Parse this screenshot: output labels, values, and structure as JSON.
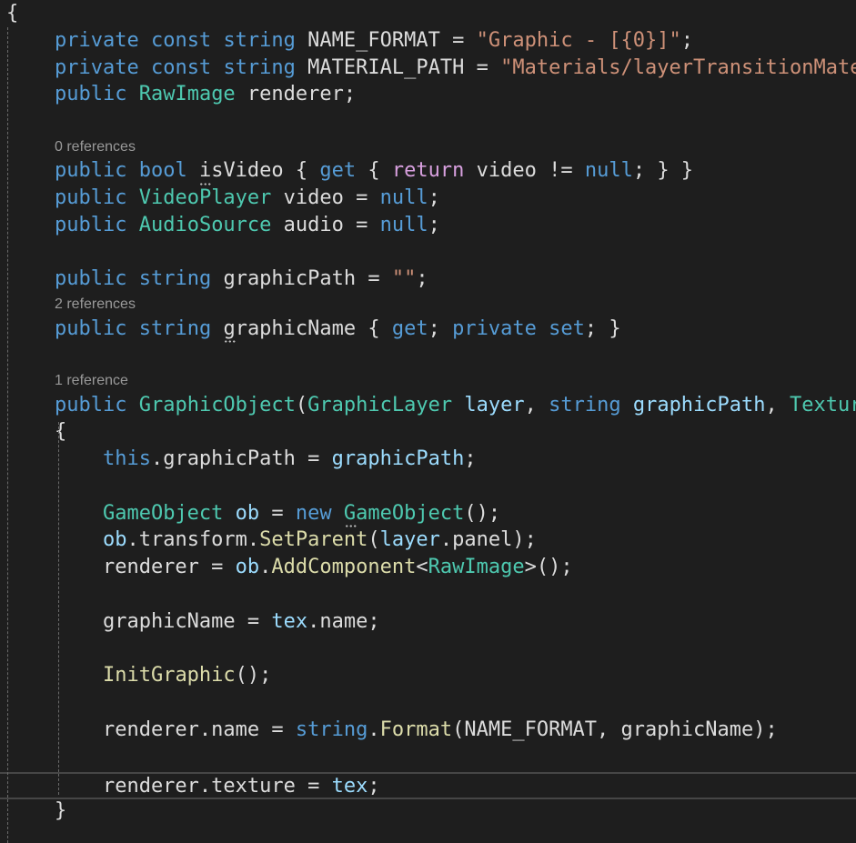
{
  "colors": {
    "background": "#1e1e1e",
    "keyword": "#569cd6",
    "type": "#4ec9b0",
    "string": "#ce9178",
    "variable": "#9cdcfe",
    "method": "#dcdcaa",
    "control": "#d8a0df",
    "text": "#dcdcdc",
    "codelens": "#999999"
  },
  "lines": [
    {
      "tokens": [
        [
          "{",
          "tx"
        ]
      ]
    },
    {
      "tokens": [
        [
          "    ",
          "tx"
        ],
        [
          "private",
          "kw"
        ],
        [
          " ",
          "tx"
        ],
        [
          "const",
          "kw"
        ],
        [
          " ",
          "tx"
        ],
        [
          "string",
          "kw"
        ],
        [
          " NAME_FORMAT = ",
          "tx"
        ],
        [
          "\"Graphic - [{0}]\"",
          "st"
        ],
        [
          ";",
          "tx"
        ]
      ]
    },
    {
      "tokens": [
        [
          "    ",
          "tx"
        ],
        [
          "private",
          "kw"
        ],
        [
          " ",
          "tx"
        ],
        [
          "const",
          "kw"
        ],
        [
          " ",
          "tx"
        ],
        [
          "string",
          "kw"
        ],
        [
          " MATERIAL_PATH = ",
          "tx"
        ],
        [
          "\"Materials/layerTransitionMate",
          "st"
        ]
      ]
    },
    {
      "tokens": [
        [
          "    ",
          "tx"
        ],
        [
          "public",
          "kw"
        ],
        [
          " ",
          "tx"
        ],
        [
          "RawImage",
          "ty"
        ],
        [
          " renderer;",
          "tx"
        ]
      ]
    },
    {
      "tokens": []
    },
    {
      "lens": "0 references"
    },
    {
      "tokens": [
        [
          "    ",
          "tx"
        ],
        [
          "public",
          "kw"
        ],
        [
          " ",
          "tx"
        ],
        [
          "bool",
          "kw"
        ],
        [
          " isVideo { ",
          "tx"
        ],
        [
          "get",
          "kw"
        ],
        [
          " { ",
          "tx"
        ],
        [
          "return",
          "ctl"
        ],
        [
          " video != ",
          "tx"
        ],
        [
          "null",
          "kw"
        ],
        [
          "; } }",
          "tx"
        ]
      ]
    },
    {
      "tokens": [
        [
          "    ",
          "tx"
        ],
        [
          "public",
          "kw"
        ],
        [
          " ",
          "tx"
        ],
        [
          "VideoPlayer",
          "ty"
        ],
        [
          " video = ",
          "tx"
        ],
        [
          "null",
          "kw"
        ],
        [
          ";",
          "tx"
        ]
      ]
    },
    {
      "tokens": [
        [
          "    ",
          "tx"
        ],
        [
          "public",
          "kw"
        ],
        [
          " ",
          "tx"
        ],
        [
          "AudioSource",
          "ty"
        ],
        [
          " audio = ",
          "tx"
        ],
        [
          "null",
          "kw"
        ],
        [
          ";",
          "tx"
        ]
      ]
    },
    {
      "tokens": []
    },
    {
      "tokens": [
        [
          "    ",
          "tx"
        ],
        [
          "public",
          "kw"
        ],
        [
          " ",
          "tx"
        ],
        [
          "string",
          "kw"
        ],
        [
          " graphicPath = ",
          "tx"
        ],
        [
          "\"\"",
          "st"
        ],
        [
          ";",
          "tx"
        ]
      ]
    },
    {
      "lens": "2 references"
    },
    {
      "tokens": [
        [
          "    ",
          "tx"
        ],
        [
          "public",
          "kw"
        ],
        [
          " ",
          "tx"
        ],
        [
          "string",
          "kw"
        ],
        [
          " graphicName { ",
          "tx"
        ],
        [
          "get",
          "kw"
        ],
        [
          "; ",
          "tx"
        ],
        [
          "private",
          "kw"
        ],
        [
          " ",
          "tx"
        ],
        [
          "set",
          "kw"
        ],
        [
          "; }",
          "tx"
        ]
      ]
    },
    {
      "tokens": []
    },
    {
      "lens": "1 reference"
    },
    {
      "tokens": [
        [
          "    ",
          "tx"
        ],
        [
          "public",
          "kw"
        ],
        [
          " ",
          "tx"
        ],
        [
          "GraphicObject",
          "ty"
        ],
        [
          "(",
          "tx"
        ],
        [
          "GraphicLayer",
          "ty"
        ],
        [
          " ",
          "tx"
        ],
        [
          "layer",
          "va"
        ],
        [
          ", ",
          "tx"
        ],
        [
          "string",
          "kw"
        ],
        [
          " ",
          "tx"
        ],
        [
          "graphicPath",
          "va"
        ],
        [
          ", ",
          "tx"
        ],
        [
          "Textur",
          "ty"
        ]
      ]
    },
    {
      "tokens": [
        [
          "    {",
          "tx"
        ]
      ]
    },
    {
      "tokens": [
        [
          "        ",
          "tx"
        ],
        [
          "this",
          "kw"
        ],
        [
          ".graphicPath = ",
          "tx"
        ],
        [
          "graphicPath",
          "va"
        ],
        [
          ";",
          "tx"
        ]
      ]
    },
    {
      "tokens": []
    },
    {
      "tokens": [
        [
          "        ",
          "tx"
        ],
        [
          "GameObject",
          "ty"
        ],
        [
          " ",
          "tx"
        ],
        [
          "ob",
          "va"
        ],
        [
          " = ",
          "tx"
        ],
        [
          "new",
          "kw"
        ],
        [
          " ",
          "tx"
        ],
        [
          "GameObject",
          "ty"
        ],
        [
          "();",
          "tx"
        ]
      ]
    },
    {
      "tokens": [
        [
          "        ",
          "tx"
        ],
        [
          "ob",
          "va"
        ],
        [
          ".transform.",
          "tx"
        ],
        [
          "SetParent",
          "fn"
        ],
        [
          "(",
          "tx"
        ],
        [
          "layer",
          "va"
        ],
        [
          ".panel);",
          "tx"
        ]
      ]
    },
    {
      "tokens": [
        [
          "        renderer = ",
          "tx"
        ],
        [
          "ob",
          "va"
        ],
        [
          ".",
          "tx"
        ],
        [
          "AddComponent",
          "fn"
        ],
        [
          "<",
          "tx"
        ],
        [
          "RawImage",
          "ty"
        ],
        [
          ">();",
          "tx"
        ]
      ]
    },
    {
      "tokens": []
    },
    {
      "tokens": [
        [
          "        graphicName = ",
          "tx"
        ],
        [
          "tex",
          "va"
        ],
        [
          ".name;",
          "tx"
        ]
      ]
    },
    {
      "tokens": []
    },
    {
      "tokens": [
        [
          "        ",
          "tx"
        ],
        [
          "InitGraphic",
          "fn"
        ],
        [
          "();",
          "tx"
        ]
      ]
    },
    {
      "tokens": []
    },
    {
      "tokens": [
        [
          "        renderer.name = ",
          "tx"
        ],
        [
          "string",
          "kw"
        ],
        [
          ".",
          "tx"
        ],
        [
          "Format",
          "fn"
        ],
        [
          "(NAME_FORMAT, graphicName);",
          "tx"
        ]
      ]
    },
    {
      "tokens": []
    },
    {
      "tokens": [
        [
          "        renderer.texture = ",
          "tx"
        ],
        [
          "tex",
          "va"
        ],
        [
          ";",
          "tx"
        ]
      ],
      "current": true
    },
    {
      "tokens": [
        [
          "    }",
          "tx"
        ]
      ]
    }
  ]
}
